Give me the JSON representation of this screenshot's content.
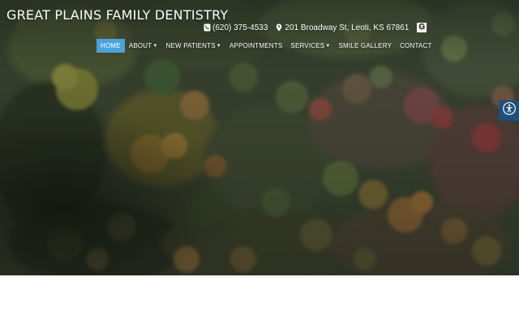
{
  "site": {
    "title": "GREAT PLAINS FAMILY DENTISTRY"
  },
  "contact": {
    "phone": "(620) 375-4533",
    "address": "201 Broadway St, Leoti, KS 67861",
    "google_icon": "google-icon",
    "phone_icon": "phone-icon",
    "map_pin_icon": "map-pin-icon"
  },
  "nav": {
    "items": [
      {
        "label": "HOME",
        "active": true,
        "dropdown": false
      },
      {
        "label": "ABOUT",
        "active": false,
        "dropdown": true
      },
      {
        "label": "NEW PATIENTS",
        "active": false,
        "dropdown": true
      },
      {
        "label": "APPOINTMENTS",
        "active": false,
        "dropdown": false
      },
      {
        "label": "SERVICES",
        "active": false,
        "dropdown": true
      },
      {
        "label": "SMILE GALLERY",
        "active": false,
        "dropdown": false
      },
      {
        "label": "CONTACT",
        "active": false,
        "dropdown": false
      }
    ],
    "active_color": "#4aa3dc"
  },
  "accessibility": {
    "icon": "accessibility-icon",
    "color": "#1f4f7b"
  },
  "hero": {
    "image": "aerial-autumn-forest"
  }
}
